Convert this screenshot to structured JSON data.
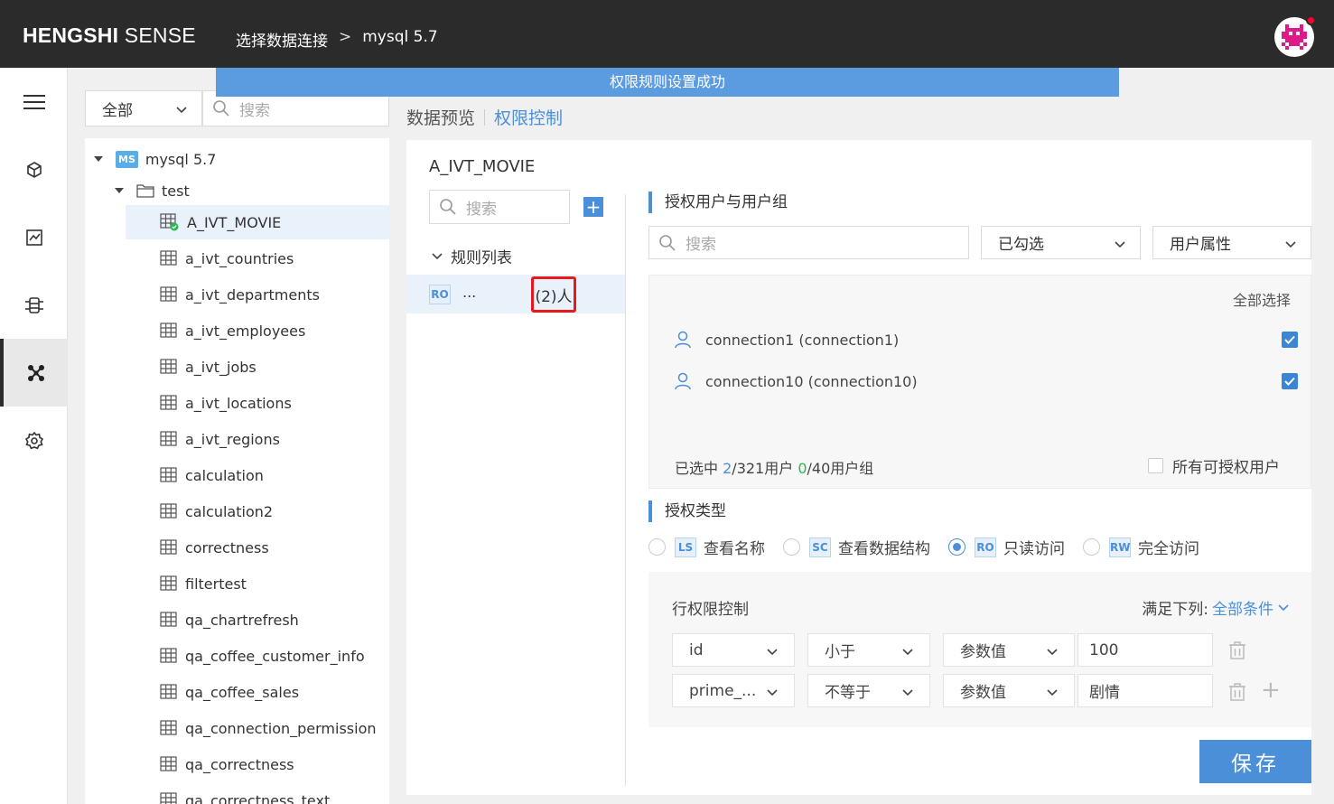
{
  "app": {
    "brand_bold": "HENGSHI",
    "brand_rest": "SENSE"
  },
  "breadcrumb": {
    "item1": "选择数据连接",
    "separator": ">",
    "item2": "mysql 5.7"
  },
  "banner": {
    "message": "权限规则设置成功"
  },
  "rail": {
    "icons": [
      "menu-icon",
      "cube-icon",
      "chart-icon",
      "dataset-icon",
      "connection-icon",
      "settings-icon"
    ],
    "active": "connection-icon"
  },
  "tree_panel": {
    "filter": {
      "selected": "全部"
    },
    "search": {
      "placeholder": "搜索"
    },
    "root": {
      "badge": "MS",
      "label": "mysql 5.7"
    },
    "folder": {
      "label": "test"
    },
    "selected_table": "A_IVT_MOVIE",
    "tables": [
      "a_ivt_countries",
      "a_ivt_departments",
      "a_ivt_employees",
      "a_ivt_jobs",
      "a_ivt_locations",
      "a_ivt_regions",
      "calculation",
      "calculation2",
      "correctness",
      "filtertest",
      "qa_chartrefresh",
      "qa_coffee_customer_info",
      "qa_coffee_sales",
      "qa_connection_permission",
      "qa_correctness",
      "qa_correctness_text"
    ]
  },
  "tabs": {
    "preview": "数据预览",
    "permission": "权限控制"
  },
  "main": {
    "table_name": "A_IVT_MOVIE",
    "rule_search_placeholder": "搜索",
    "add_label": "+",
    "rule_list_title": "规则列表",
    "rule": {
      "badge": "RO",
      "name": "...",
      "count": "(2)人"
    },
    "users_section": {
      "title": "授权用户与用户组",
      "search_placeholder": "搜索",
      "filter_selected": "已勾选",
      "filter_attr": "用户属性",
      "select_all": "全部选择",
      "users": [
        {
          "name": "connection1 (connection1)",
          "checked": true
        },
        {
          "name": "connection10 (connection10)",
          "checked": true
        }
      ],
      "footer": {
        "prefix": "已选中",
        "users_selected": "2",
        "users_total": "/321用户",
        "groups_selected": "0",
        "groups_total": "/40用户组"
      },
      "all_users_label": "所有可授权用户"
    },
    "type_section": {
      "title": "授权类型",
      "options": [
        {
          "badge": "LS",
          "label": "查看名称",
          "selected": false
        },
        {
          "badge": "SC",
          "label": "查看数据结构",
          "selected": false
        },
        {
          "badge": "RO",
          "label": "只读访问",
          "selected": true
        },
        {
          "badge": "RW",
          "label": "完全访问",
          "selected": false
        }
      ]
    },
    "row_permission": {
      "title": "行权限控制",
      "satisfy_label": "满足下列:",
      "satisfy_value": "全部条件",
      "conditions": [
        {
          "field": "id",
          "operator": "小于",
          "value_type": "参数值",
          "value": "100"
        },
        {
          "field": "prime_...",
          "operator": "不等于",
          "value_type": "参数值",
          "value": "剧情"
        }
      ]
    },
    "save_label": "保存"
  },
  "colors": {
    "accent": "#4a8fd8",
    "topbar": "#2b2b2b",
    "banner": "#5b9be0",
    "highlight": "#e8191b",
    "success": "#2db84d"
  }
}
